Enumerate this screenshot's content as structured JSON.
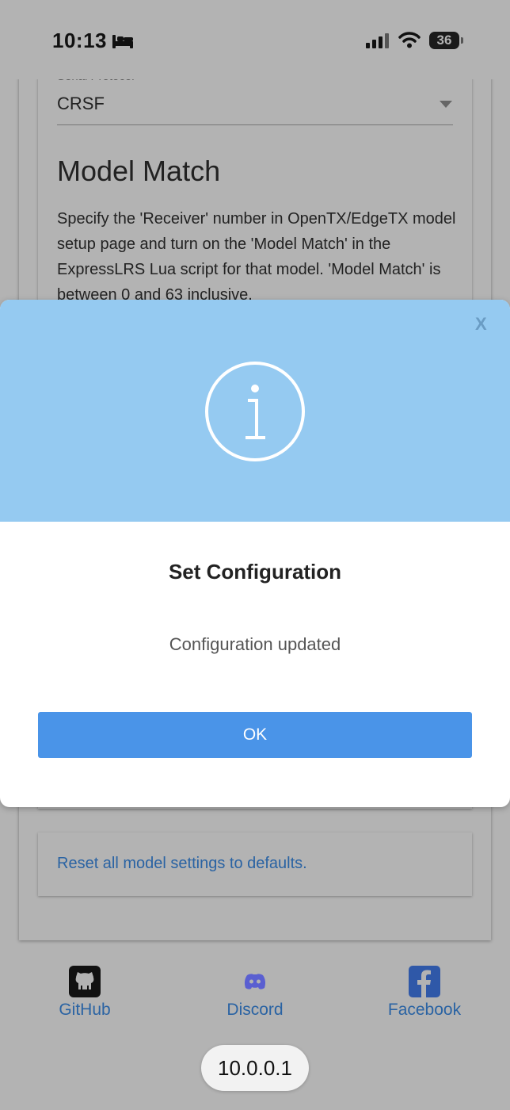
{
  "status_bar": {
    "time": "10:13",
    "battery_level": "36",
    "icons": [
      "bed-icon",
      "signal-icon",
      "wifi-icon",
      "battery-icon"
    ]
  },
  "form": {
    "protocol_label": "Serial Protocol",
    "protocol_value": "CRSF",
    "section_title": "Model Match",
    "section_desc": "Specify the 'Receiver' number in OpenTX/EdgeTX model setup page and turn on the 'Model Match' in the ExpressLRS Lua script for that model. 'Model Match' is between 0 and 63 inclusive."
  },
  "modal": {
    "close_label": "X",
    "icon": "info-icon",
    "title": "Set Configuration",
    "message": "Configuration updated",
    "ok_label": "OK"
  },
  "reset": {
    "link_text": "Reset all model settings to defaults."
  },
  "footer": {
    "items": [
      {
        "label": "GitHub",
        "icon": "github-icon"
      },
      {
        "label": "Discord",
        "icon": "discord-icon"
      },
      {
        "label": "Facebook",
        "icon": "facebook-icon"
      }
    ]
  },
  "browser": {
    "url": "10.0.0.1"
  },
  "colors": {
    "modal_header": "#95caf1",
    "ok_button": "#4a94e8",
    "link": "#2a63a3",
    "backdrop": "#b3b3b3"
  }
}
